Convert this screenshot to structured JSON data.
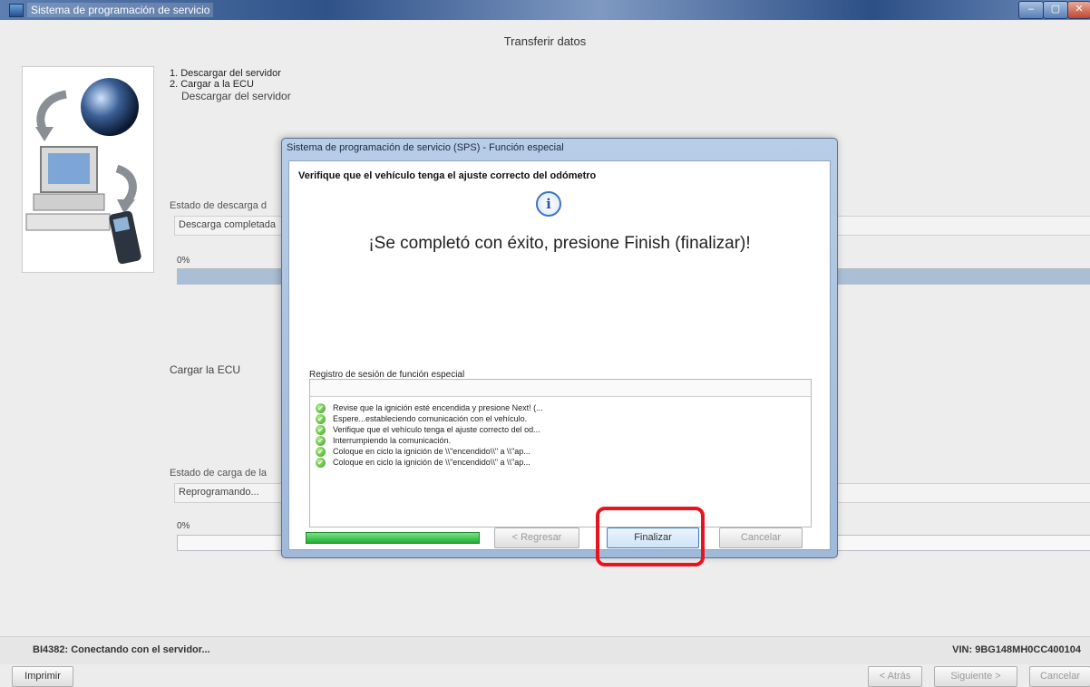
{
  "window": {
    "title": "Sistema de programación de servicio",
    "buttons": {
      "minimize": "–",
      "maximize": "▢",
      "close": "✕"
    }
  },
  "main": {
    "title": "Transferir datos",
    "steps": [
      "1. Descargar del servidor",
      "2. Cargar a la ECU"
    ],
    "download_section": {
      "label": "Descargar del servidor",
      "status_label": "Estado de descarga d",
      "status_value": "Descarga completada",
      "percent_label": "0%",
      "progress_fraction": 1.0
    },
    "upload_section": {
      "label": "Cargar la ECU",
      "status_label": "Estado de carga de la",
      "status_value": "Reprogramando...",
      "percent_label": "0%",
      "progress_fraction": 0.0
    }
  },
  "status_bar": {
    "message": "BI4382: Conectando con el servidor...",
    "vin": "VIN: 9BG148MH0CC400104"
  },
  "footer": {
    "print_label": "Imprimir",
    "back_label": "< Atrás",
    "next_label": "Siguiente >",
    "cancel_label": "Cancelar"
  },
  "dialog": {
    "title": "Sistema de programación de servicio (SPS) - Función especial",
    "heading": "Verifique que el vehículo tenga el ajuste correcto del odómetro",
    "info_icon_glyph": "i",
    "message": "¡Se completó con éxito, presione Finish (finalizar)!",
    "log_label": "Registro de sesión de función especial",
    "log_items": [
      "Revise que la ignición esté encendida y presione Next! (...",
      "Espere...estableciendo comunicación con el vehículo.",
      "Verifique que el vehículo tenga el ajuste correcto del od...",
      "Interrumpiendo la comunicación.",
      "Coloque en ciclo la ignición de \\\\\"encendido\\\\\" a \\\\\"ap...",
      "Coloque en ciclo la ignición de \\\\\"encendido\\\\\" a \\\\\"ap..."
    ],
    "progress_fraction": 1.0,
    "buttons": {
      "back": "< Regresar",
      "finish": "Finalizar",
      "cancel": "Cancelar"
    }
  },
  "colors": {
    "highlight": "#e8131c",
    "progress_green": "#1fae33"
  }
}
